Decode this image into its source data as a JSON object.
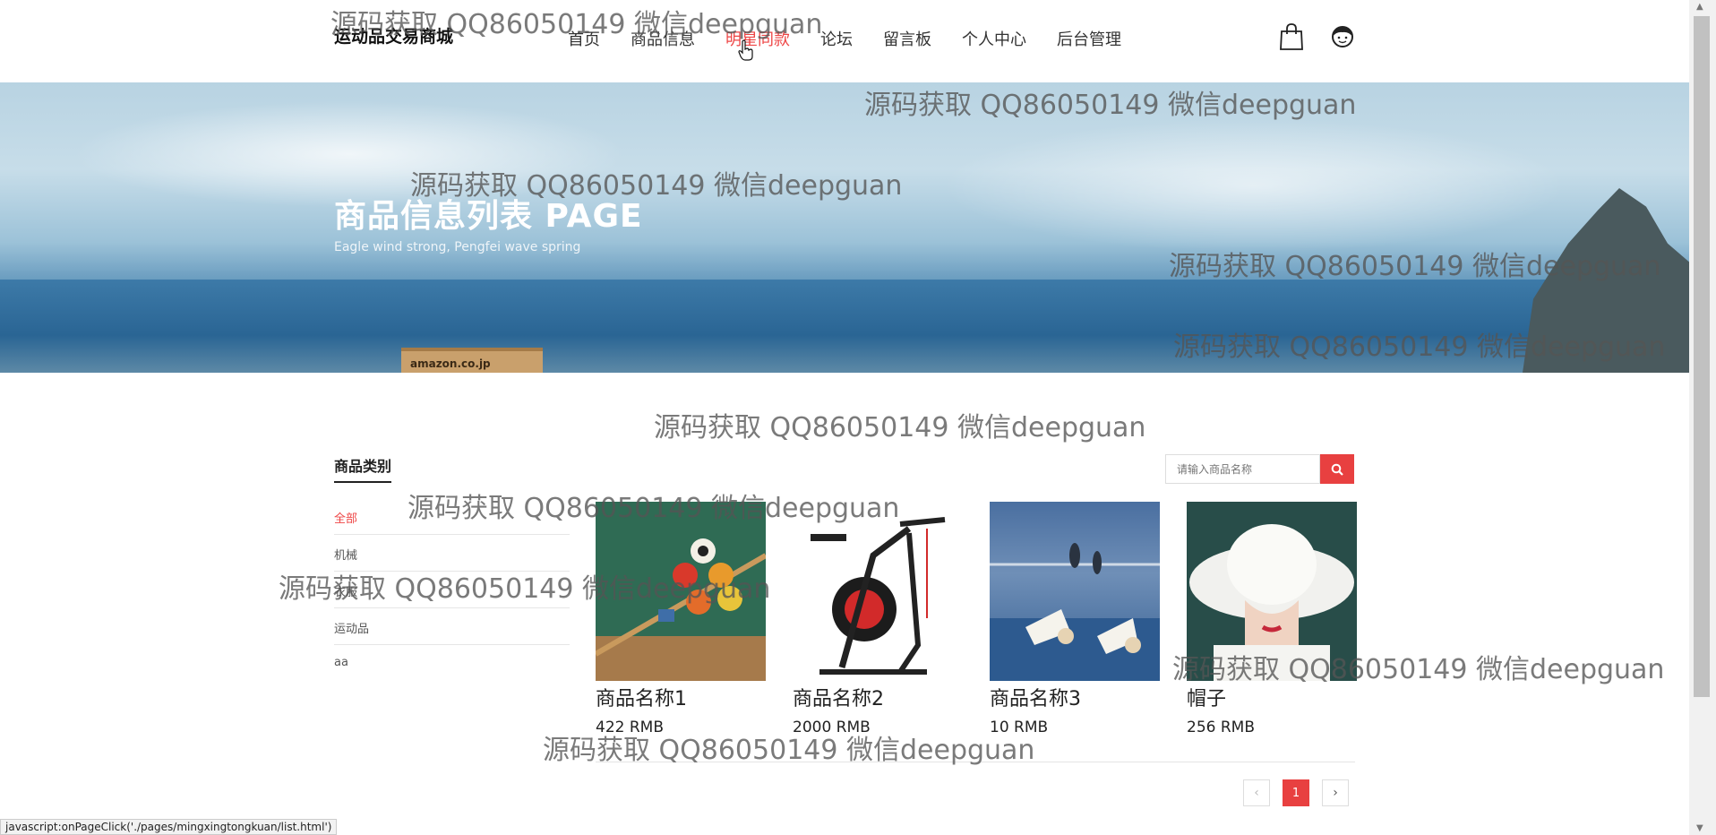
{
  "header": {
    "logo": "运动品交易商城",
    "nav": [
      {
        "label": "首页"
      },
      {
        "label": "商品信息"
      },
      {
        "label": "明星同款",
        "active": true
      },
      {
        "label": "论坛"
      },
      {
        "label": "留言板"
      },
      {
        "label": "个人中心"
      },
      {
        "label": "后台管理"
      }
    ],
    "icons": [
      "shopping-bag-icon",
      "user-avatar-icon"
    ]
  },
  "banner": {
    "title": "商品信息列表 PAGE",
    "subtitle": "Eagle wind strong, Pengfei wave spring",
    "box_label": "amazon.co.jp"
  },
  "sidebar": {
    "title": "商品类别",
    "categories": [
      {
        "label": "全部",
        "active": true
      },
      {
        "label": "机械"
      },
      {
        "label": "衣服"
      },
      {
        "label": "运动品"
      },
      {
        "label": "aa"
      }
    ]
  },
  "search": {
    "placeholder": "请输入商品名称",
    "icon": "search-icon"
  },
  "products": [
    {
      "name": "商品名称1",
      "price": "422 RMB",
      "image": "billiard-balls"
    },
    {
      "name": "商品名称2",
      "price": "2000 RMB",
      "image": "exercise-bike"
    },
    {
      "name": "商品名称3",
      "price": "10 RMB",
      "image": "badminton-shuttlecocks"
    },
    {
      "name": "帽子",
      "price": "256 RMB",
      "image": "white-sun-hat"
    }
  ],
  "pagination": {
    "prev": "‹",
    "current": "1",
    "next": "›"
  },
  "watermark": "源码获取 QQ86050149 微信deepguan",
  "statusbar": "javascript:onPageClick('./pages/mingxingtongkuan/list.html')",
  "colors": {
    "accent": "#e84040",
    "active_text": "#e44"
  }
}
